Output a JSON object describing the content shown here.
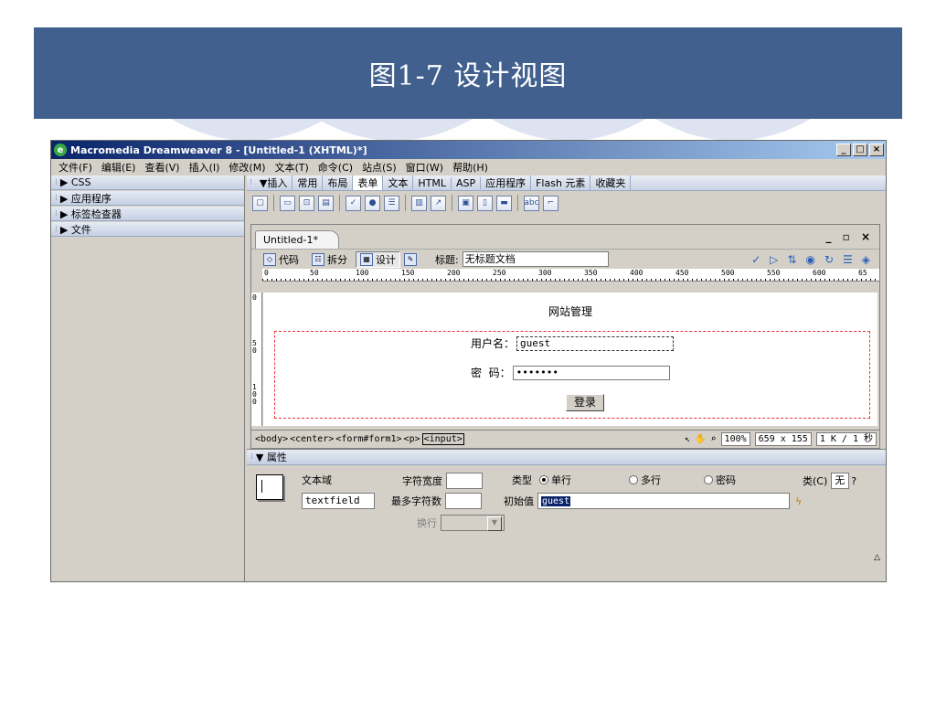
{
  "slide": {
    "title": "图1-7   设计视图"
  },
  "window": {
    "title": "Macromedia Dreamweaver 8 - [Untitled-1 (XHTML)*]",
    "min": "_",
    "max": "□",
    "close": "×"
  },
  "menu": [
    "文件(F)",
    "编辑(E)",
    "查看(V)",
    "插入(I)",
    "修改(M)",
    "文本(T)",
    "命令(C)",
    "站点(S)",
    "窗口(W)",
    "帮助(H)"
  ],
  "left_panels": [
    "▶ CSS",
    "▶ 应用程序",
    "▶ 标签检查器",
    "▶ 文件"
  ],
  "insert_bar": {
    "label": "▼插入",
    "tabs": [
      "常用",
      "布局",
      "表单",
      "文本",
      "HTML",
      "ASP",
      "应用程序",
      "Flash 元素",
      "收藏夹"
    ],
    "active": "表单"
  },
  "document": {
    "tab": "Untitled-1*",
    "controls": "_ ▫ ×",
    "views": {
      "code": "代码",
      "split": "拆分",
      "design": "设计"
    },
    "title_label": "标题:",
    "title_value": "无标题文档",
    "ruler_h": [
      "0",
      "50",
      "100",
      "150",
      "200",
      "250",
      "300",
      "350",
      "400",
      "450",
      "500",
      "550",
      "600",
      "65"
    ],
    "ruler_v": [
      "0",
      "50",
      "100"
    ],
    "heading": "网站管理",
    "username_label": "用户名：",
    "username_value": "guest",
    "password_label": "密  码：",
    "password_value": "•••••••",
    "login_button": "登录",
    "status_tags": [
      "<body>",
      "<center>",
      "<form#form1>",
      "<p>",
      "<input>"
    ],
    "zoom": "100%",
    "size": "659 x 155",
    "download": "1 K / 1 秒"
  },
  "properties": {
    "header": "▼ 属性",
    "field_type": "文本域",
    "field_name": "textfield",
    "char_width_label": "字符宽度",
    "max_chars_label": "最多字符数",
    "type_label": "类型",
    "type_single": "单行",
    "type_multi": "多行",
    "type_password": "密码",
    "init_value_label": "初始值",
    "init_value": "guest",
    "class_label": "类(C)",
    "class_value": "无",
    "wrap_label": "换行"
  }
}
